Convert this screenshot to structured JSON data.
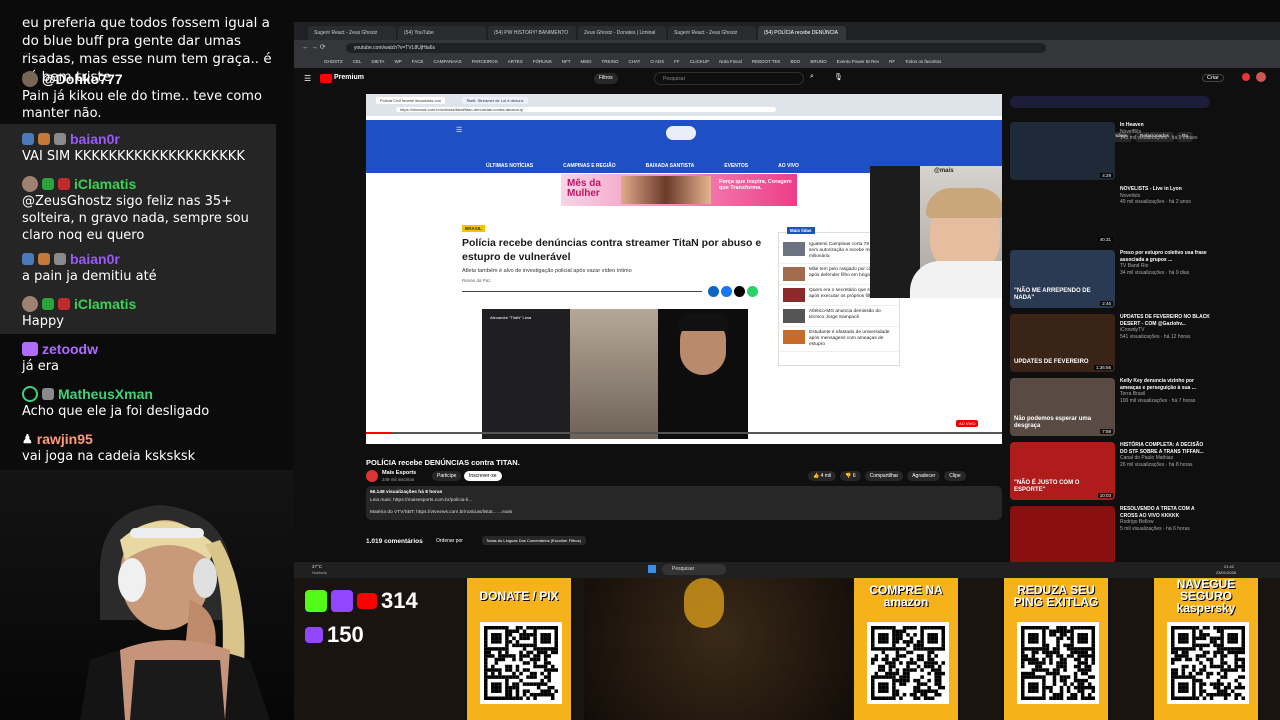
{
  "chat": [
    {
      "user": "",
      "text": "eu preferia que todos fossem igual a do blue buff pra gente dar umas risadas, mas esse num tem graça.. é só bem triste",
      "color": "#ffffff"
    },
    {
      "user": "@Dohko777",
      "text": "Pain já kikou ele do time.. teve como manter não.",
      "color": "#ffffff"
    },
    {
      "user": "baian0r",
      "text": "VAI SIM KKKKKKKKKKKKKKKKKKKK",
      "color": "#9b59ff"
    },
    {
      "user": "iClamatis",
      "text": "@ZeusGhostz sigo feliz nas 35+ solteira, n gravo nada, sempre sou claro noq eu quero",
      "color": "#39d353"
    },
    {
      "user": "baian0r",
      "text": "a pain ja demitiu até",
      "color": "#9b59ff"
    },
    {
      "user": "iClamatis",
      "text": "Happy",
      "color": "#39d353"
    },
    {
      "user": "zetoodw",
      "text": "já era",
      "color": "#b06bff"
    },
    {
      "user": "MatheusXman",
      "text": "Acho que ele ja foi desligado",
      "color": "#42d17a"
    },
    {
      "user": "rawjin95",
      "text": "vai joga na cadeia ksksksk",
      "color": "#ff9a7a"
    }
  ],
  "browser": {
    "tabs": [
      "Sugerir React - Zeus Ghostz",
      "(54) YouTube",
      "(54) PW HISTORY! BANIMENTO",
      "Zeus Ghostz - Donates | Liminal",
      "Sugerir React - Zeus Ghostz",
      "(54) POLÍCIA recebe DENÚNCIA"
    ],
    "url": "youtube.com/watch?v=TVL8UjHta6s",
    "bookmarks": [
      "GHOSTZ",
      "CEL",
      "DIETA",
      "WP",
      "FACE",
      "CAMPANHAS",
      "PARCEIROS",
      "ARTES",
      "FÓRUNS",
      "NFT",
      "MMO",
      "TREINO",
      "CHAT",
      "O ADS",
      "FF",
      "CLICKUP",
      "Nota Fiscal",
      "REBOOT TEK",
      "BDO",
      "BRUNO",
      "Evento Power Bi Rev",
      "RF",
      "Todos os favoritos"
    ]
  },
  "youtube": {
    "logo": "Premium",
    "search_placeholder": "Pesquisar",
    "filters_label": "Filtros",
    "create_label": "Criar",
    "video_title": "POLÍCIA recebe DENÚNCIAS contra TITAN.",
    "channel": "Mais Esports",
    "subscribers": "249 mil inscritos",
    "join_label": "Participe",
    "subscribe_label": "Inscrever-se",
    "likes": "4 mil",
    "dislikes": "6",
    "share_label": "Compartilhar",
    "thanks_label": "Agradecer",
    "clip_label": "Clipe",
    "views": "66.148 visualizações há 8 horas",
    "desc_line1": "Leia mais: https://maisesports.com.br/policia-li...",
    "desc_line2": "Matéria do VTV/SBT: https://vtvnews.com.br/noticias/listat... ...mais",
    "comments": "1.019 comentários",
    "sort_label": "Ordenar por",
    "translate_label": "Todas As Línguas Dos Comentários (Escolher Filtros)",
    "time": "0:19 / 7:56",
    "chips": [
      "Todos",
      "De Mais Esports",
      "Notícias mundiais",
      "Relacionados",
      "Pa"
    ]
  },
  "article": {
    "inner_url": "https://vtvnews.com.br/noticias/listat/titan-denuncias-contra-abusos-rj/",
    "tabs": [
      "Polícia Civil recebe denúncias con",
      "TitaN: Streamer de Lol é denunc"
    ],
    "nav": [
      "ÚLTIMAS NOTÍCIAS",
      "CAMPINAS E REGIÃO",
      "BAIXADA SANTISTA",
      "EVENTOS",
      "AO VIVO"
    ],
    "ad_left": "Mês da Mulher",
    "ad_right": "Força que Inspira, Coragem que Transforma.",
    "tag": "BRASIL",
    "title": "Polícia recebe denúncias contra streamer TitaN por abuso e estupro de vulnerável",
    "subtitle": "Atleta também é alvo de investigação policial após vazar vídeo íntimo",
    "byline": "Renan da Paz",
    "chat_name": "Alexandre \"TitaN\" Lima",
    "mais_lidas_title": "Mais lidas",
    "mais_lidas": [
      "Iguatemi Campinas corta 78 árvores sem autorização e recebe multa milionária",
      "Mãe tem pelo rasgado por cão de vídeo após defender filho em briga escolar",
      "Quem era o secretário que se matou após executar os próprios filhos?",
      "Atlético-MG anuncia demissão do técnico Jorge Sampaoli",
      "Estudante é afastado de universidade após mensagens com ameaças de estupro"
    ],
    "webcam_tag": "@mais",
    "ao_vivo": "AO VIVO"
  },
  "recommendations": [
    {
      "title": "In Heaven",
      "channel": "NovelBits",
      "meta": "143 mil visualizações · há 9 meses",
      "dur": "4:29",
      "color": "#1e2a38"
    },
    {
      "title": "NOVELISTS - Live in Lyon",
      "channel": "Novelists",
      "meta": "49 mil visualizações · há 2 anos",
      "dur": "40:31",
      "color": "#101010"
    },
    {
      "title": "Preso por estupro coletivo usa frase associada a grupos ...",
      "channel": "TV Band Rio",
      "meta": "34 mil visualizações · há 9 dias",
      "dur": "2:45",
      "thumb_text": "\"NÃO ME ARREPENDO DE NADA\"",
      "color": "#2a3a52"
    },
    {
      "title": "UPDATES DE FEVEREIRO NO BLACK DESERT - COM @Gazlohv...",
      "channel": "iCrowdyTV",
      "meta": "541 visualizações · há 12 horas",
      "dur": "1:36:56",
      "thumb_text": "UPDATES DE FEVEREIRO",
      "color": "#3a2418"
    },
    {
      "title": "Kelly Key denuncia vizinho por ameaças e perseguição à sua ...",
      "channel": "Terra Brasil",
      "meta": "100 mil visualizações · há 7 horas",
      "dur": "7:59",
      "thumb_text": "Não podemos esperar uma desgraça",
      "color": "#5a4a44"
    },
    {
      "title": "HISTÓRIA COMPLETA: A DECISÃO DO STF SOBRE A TRANS TIFFAN...",
      "channel": "Canal do Paulo Mathias",
      "meta": "26 mil visualizações · há 8 horas",
      "dur": "10:03",
      "thumb_text": "\"NÃO É JUSTO COM O ESPORTE\"",
      "color": "#b01c1c"
    },
    {
      "title": "RESOLVENDO A TRETA COM A CROSS AO VIVO KKKKK",
      "channel": "Rodrigo Bellow",
      "meta": "5 mil visualizações · há 6 horas",
      "dur": "",
      "color": "#8a1010"
    }
  ],
  "taskbar": {
    "search": "Pesquisar",
    "weather": "27°C",
    "weather_desc": "Nublado",
    "clock": "21:42",
    "date": "23/01/2026"
  },
  "overlay": {
    "twitch_yt_count": "314",
    "second_count": "150"
  },
  "qr_panels": [
    {
      "title": "DONATE / PIX",
      "color": "#f6b21a"
    },
    {
      "title": "COMPRE NA amazon",
      "color": "#f6b21a"
    },
    {
      "title": "REDUZA SEU PING EXITLAG",
      "color": "#f6b21a"
    },
    {
      "title": "NAVEGUE SEGURO kaspersky",
      "color": "#f6b21a"
    }
  ]
}
